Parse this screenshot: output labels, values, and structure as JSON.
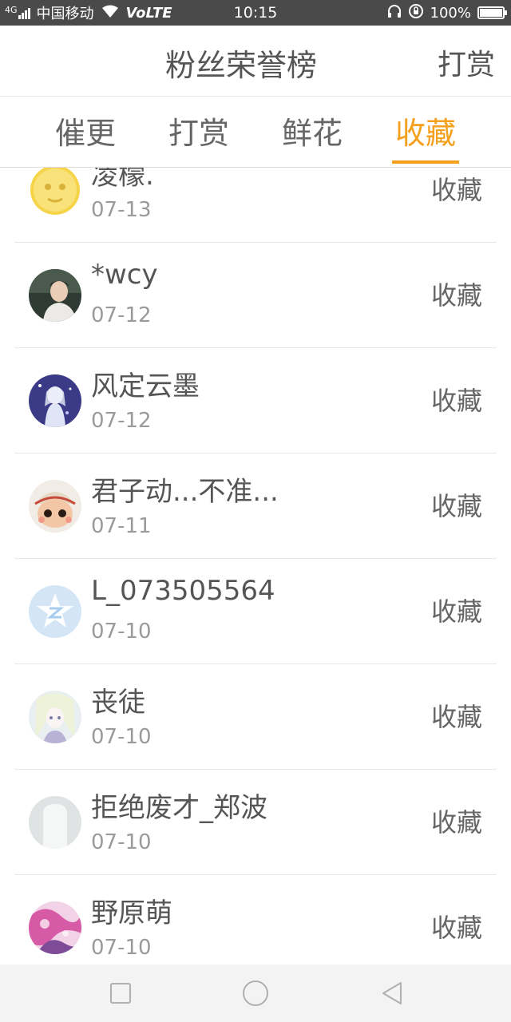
{
  "status_bar": {
    "signal": "4G",
    "carrier": "中国移动",
    "volte": "VoLTE",
    "time": "10:15",
    "battery": "100%",
    "battery_level": 1.0,
    "icons": [
      "signal-icon",
      "wifi-icon",
      "headphones-icon",
      "rotation-lock-icon",
      "battery-icon"
    ]
  },
  "header": {
    "title": "粉丝荣誉榜",
    "action_label": "打赏"
  },
  "tabs": [
    {
      "label": "催更",
      "active": false
    },
    {
      "label": "打赏",
      "active": false
    },
    {
      "label": "鲜花",
      "active": false
    },
    {
      "label": "收藏",
      "active": true
    }
  ],
  "list": {
    "items": [
      {
        "name": "凌檬.",
        "date": "07-13",
        "action": "收藏",
        "avatar": "moon-emoji"
      },
      {
        "name": "*wcy",
        "date": "07-12",
        "action": "收藏",
        "avatar": "photo-person"
      },
      {
        "name": "风定云墨",
        "date": "07-12",
        "action": "收藏",
        "avatar": "anime-girl-blue"
      },
      {
        "name": "君子动...不准...",
        "date": "07-11",
        "action": "收藏",
        "avatar": "cartoon-doll"
      },
      {
        "name": "L_073505564",
        "date": "07-10",
        "action": "收藏",
        "avatar": "qzone-star"
      },
      {
        "name": "丧徒",
        "date": "07-10",
        "action": "收藏",
        "avatar": "anime-girl-pale"
      },
      {
        "name": "拒绝废才_郑波",
        "date": "07-10",
        "action": "收藏",
        "avatar": "default-avatar"
      },
      {
        "name": "野原萌",
        "date": "07-10",
        "action": "收藏",
        "avatar": "pink-illustration"
      }
    ]
  },
  "navbar": {
    "buttons": [
      "recent-apps-icon",
      "home-icon",
      "back-icon"
    ]
  },
  "colors": {
    "accent": "#f5a01c",
    "status_bar": "#4a4a4a",
    "text": "#555555",
    "subtext": "#9a9a9a"
  }
}
